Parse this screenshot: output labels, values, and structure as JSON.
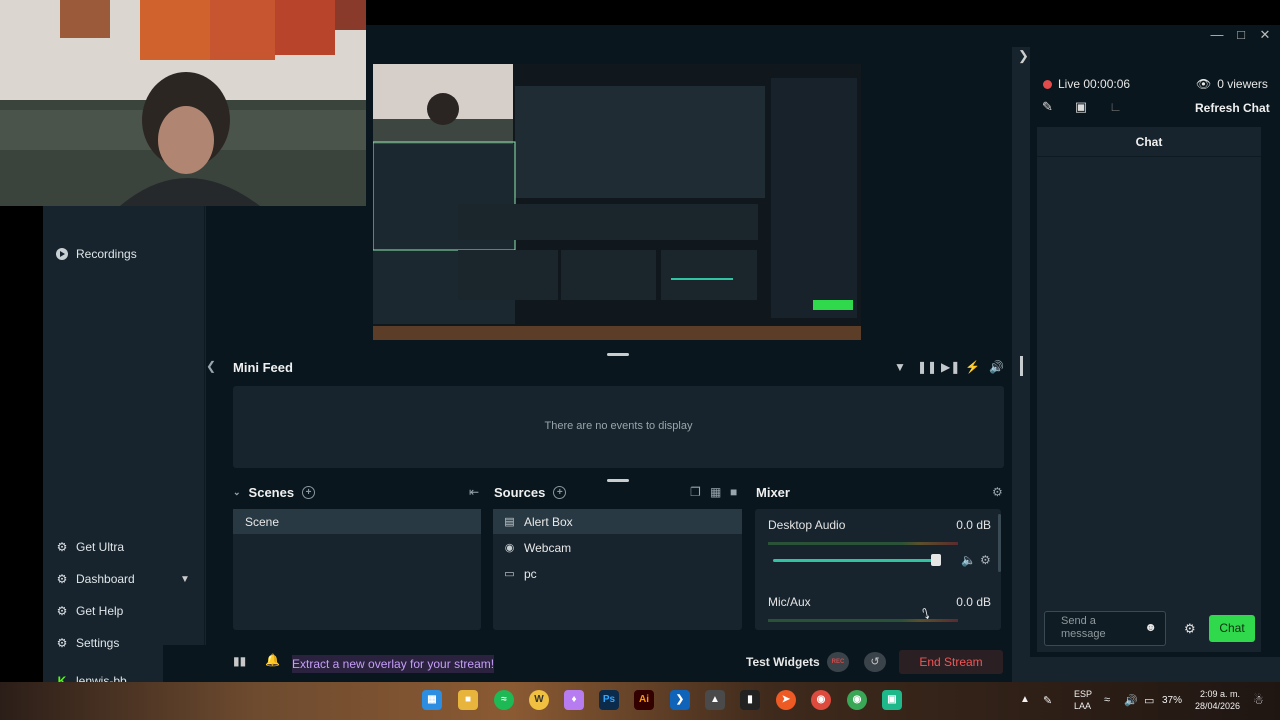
{
  "left_nav": {
    "recordings": "Recordings",
    "get_ultra": "Get Ultra",
    "dashboard": "Dashboard",
    "get_help": "Get Help",
    "settings": "Settings",
    "username": "lenwis-bb"
  },
  "mini_feed": {
    "title": "Mini Feed",
    "empty": "There are no events to display"
  },
  "scenes": {
    "title": "Scenes",
    "items": [
      "Scene"
    ]
  },
  "sources": {
    "title": "Sources",
    "items": [
      "Alert Box",
      "Webcam",
      "pc"
    ]
  },
  "mixer": {
    "title": "Mixer",
    "channels": [
      {
        "name": "Desktop Audio",
        "level": "0.0 dB"
      },
      {
        "name": "Mic/Aux",
        "level": "0.0 dB"
      }
    ],
    "desktop_volume_fraction": 0.98
  },
  "footer": {
    "promo": "Extract a new overlay for your stream!",
    "test_widgets": "Test Widgets",
    "rec": "REC",
    "end_stream": "End Stream"
  },
  "chat": {
    "live": "Live 00:00:06",
    "viewers": "0 viewers",
    "refresh": "Refresh Chat",
    "header": "Chat",
    "input_placeholder": "Send a message",
    "send": "Chat"
  },
  "taskbar": {
    "lang_1": "ESP",
    "lang_2": "LAA",
    "battery": "37%",
    "time": "2:09 a. m.",
    "date": "28/04/2026"
  },
  "colors": {
    "app_bg": "#17242d",
    "dark_bg": "#09161d",
    "accent_green": "#30d94b",
    "live_red": "#e24b4b",
    "promo_purple": "#c49ef7"
  }
}
